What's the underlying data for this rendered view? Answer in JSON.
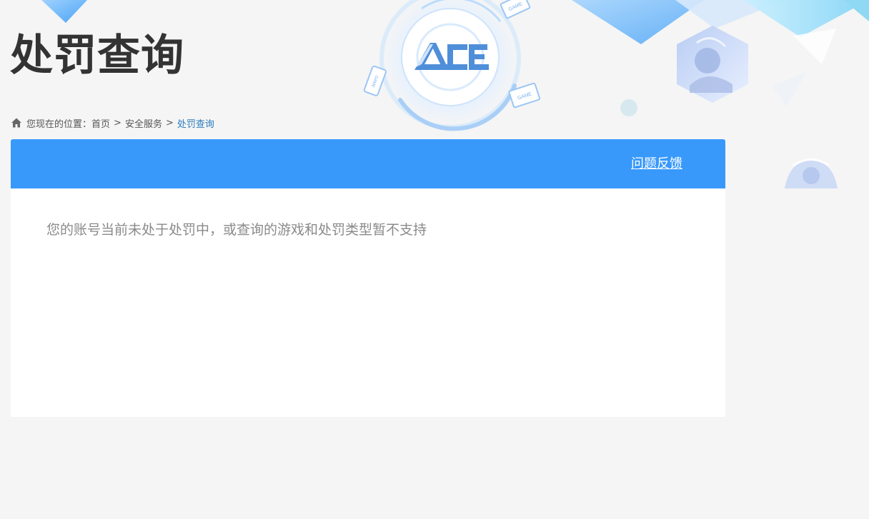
{
  "header": {
    "title": "处罚查询",
    "logo_text": "ACE",
    "decor_labels": [
      "GAME",
      "GAME",
      "GAME"
    ]
  },
  "breadcrumb": {
    "prefix": "您现在的位置：",
    "items": [
      "首页",
      "安全服务"
    ],
    "current": "处罚查询",
    "separator": ">",
    "icon": "home-icon"
  },
  "panel": {
    "header_color": "#3899fb",
    "feedback_label": "问题反馈",
    "message": "您的账号当前未处于处罚中，或查询的游戏和处罚类型暂不支持"
  },
  "colors": {
    "background": "#f5f5f5",
    "accent": "#3899fb",
    "breadcrumb_current": "#2b7bbd"
  }
}
